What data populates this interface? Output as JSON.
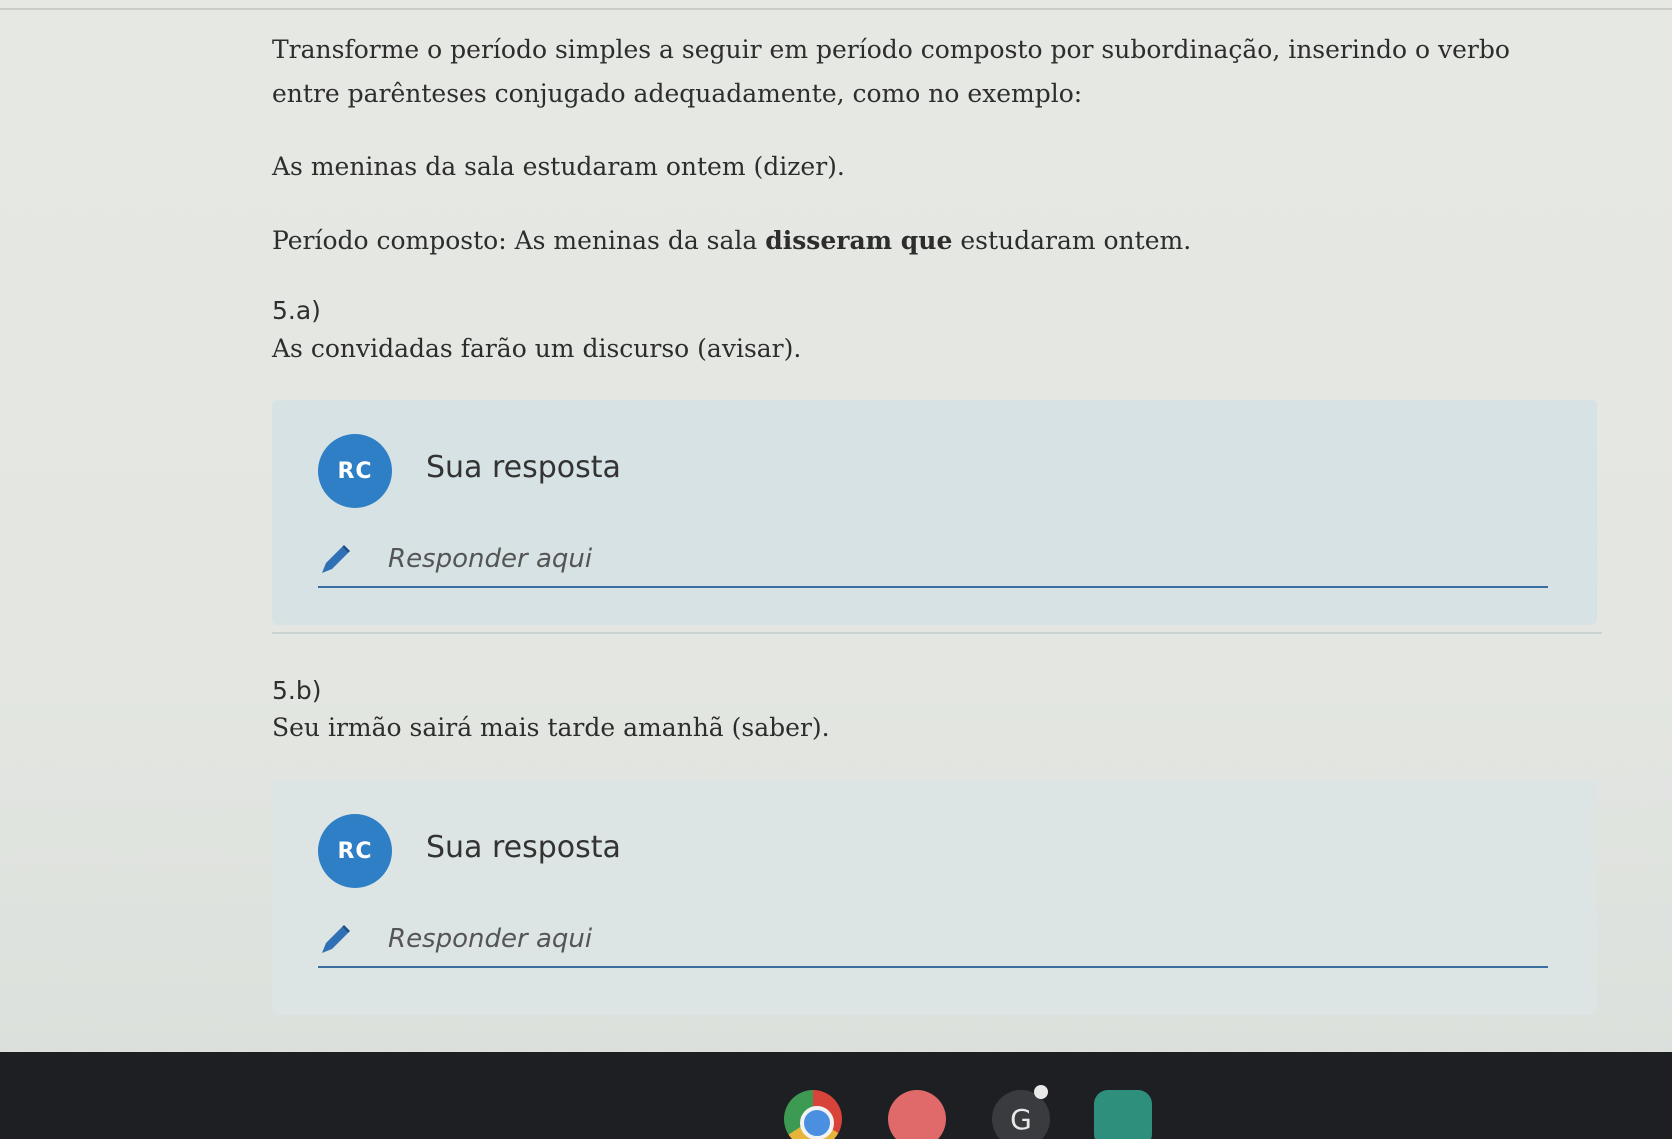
{
  "instructions": "Transforme o período simples a seguir em período composto por subordinação, inserindo o verbo entre parênteses conjugado adequadamente, como no exemplo:",
  "example": {
    "sentence": "As meninas da sala estudaram ontem (dizer).",
    "composite_prefix": "Período composto: As meninas da sala ",
    "composite_bold": "disseram que",
    "composite_suffix": " estudaram ontem."
  },
  "questions": [
    {
      "number": "5.a)",
      "text": "As convidadas farão um discurso (avisar).",
      "avatar": "RC",
      "answer_label": "Sua resposta",
      "placeholder": "Responder aqui"
    },
    {
      "number": "5.b)",
      "text": "Seu irmão sairá mais tarde amanhã (saber).",
      "avatar": "RC",
      "answer_label": "Sua resposta",
      "placeholder": "Responder aqui"
    }
  ],
  "shelf": {
    "apps": [
      "chrome-icon",
      "photos-icon",
      "google-icon",
      "classroom-icon"
    ],
    "google_letter": "G"
  },
  "colors": {
    "accent": "#2f7fc6",
    "card": "#d6e2e3",
    "taskbar": "#1e1f22"
  }
}
